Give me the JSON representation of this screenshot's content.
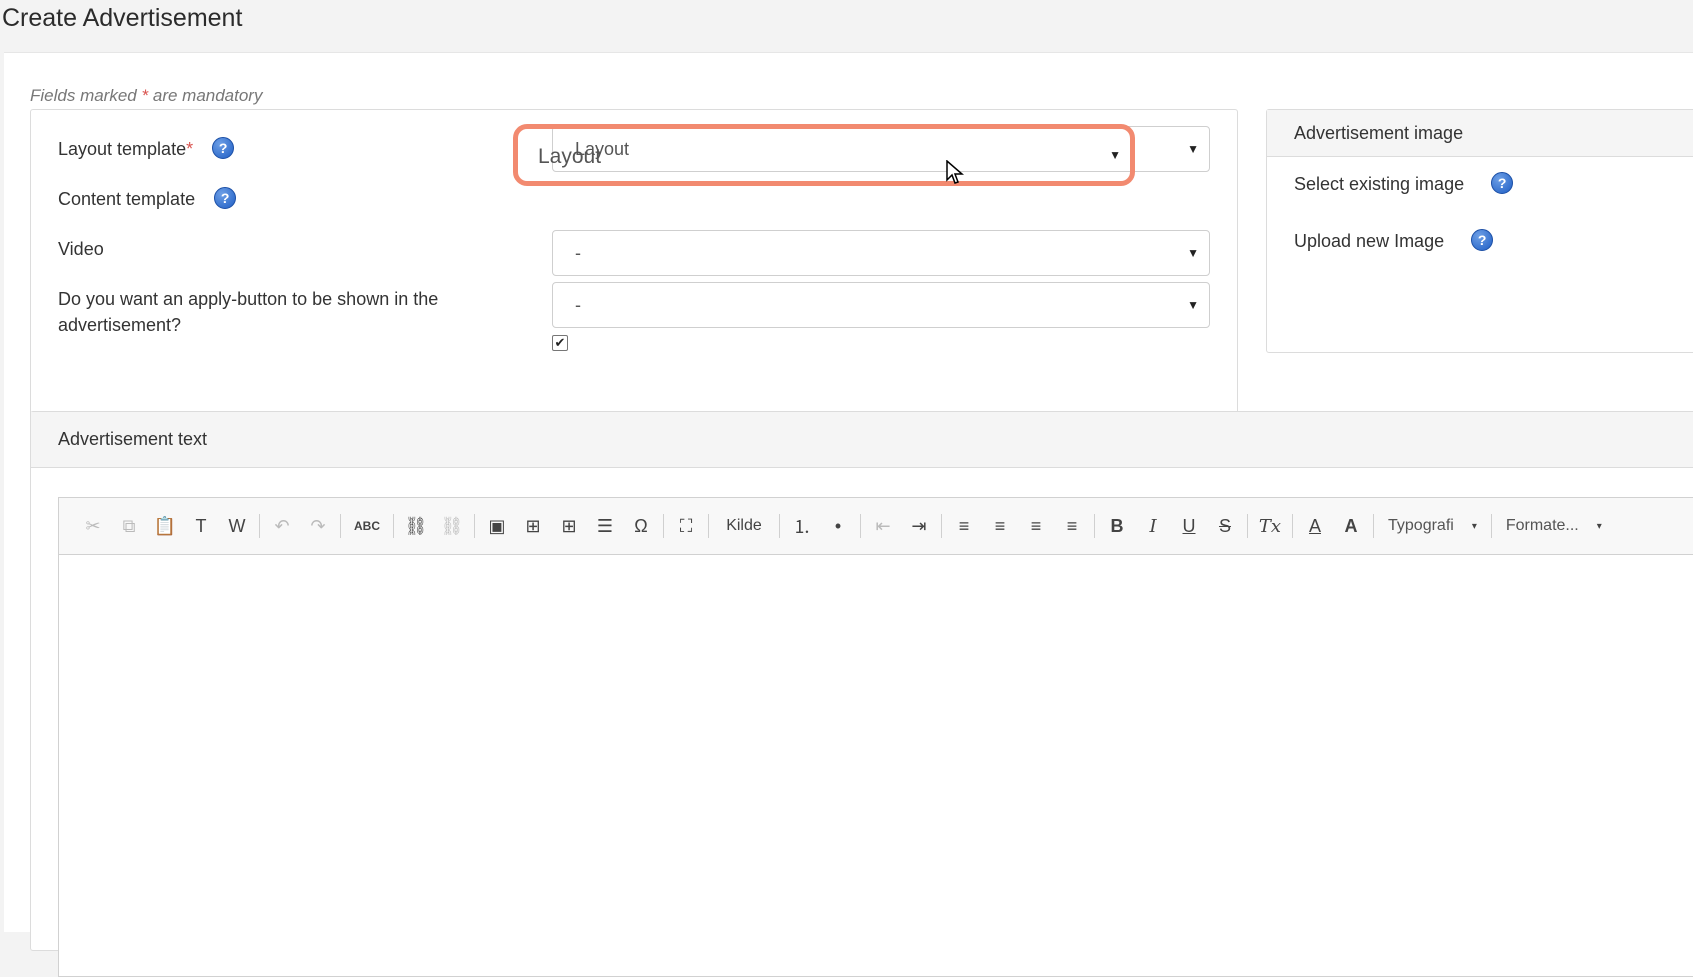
{
  "page": {
    "title": "Create Advertisement"
  },
  "form": {
    "mandatory_prefix": "Fields marked",
    "mandatory_star": "*",
    "mandatory_suffix": "are mandatory",
    "layout_template": {
      "label": "Layout template",
      "required_mark": "*",
      "value": "Layout"
    },
    "content_template": {
      "label": "Content template",
      "value": "-"
    },
    "video": {
      "label": "Video",
      "value": "-"
    },
    "apply_button": {
      "label_line1": "Do you want an apply-button to be shown in the",
      "label_line2": "advertisement?",
      "checked": true,
      "check_glyph": "✔"
    }
  },
  "image_panel": {
    "heading": "Advertisement image",
    "select_existing": "Select existing image",
    "upload_new": "Upload new Image"
  },
  "text_panel": {
    "heading": "Advertisement text",
    "toolbar": {
      "source_label": "Kilde",
      "typography_label": "Typografi",
      "format_label": "Formate..."
    }
  },
  "icons": {
    "help": "?",
    "caret": "▼",
    "dropdown_arrow": "▾",
    "cut": "✂",
    "copy": "⧉",
    "paste": "📋",
    "paste_text": "T",
    "paste_word": "W",
    "undo": "↶",
    "redo": "↷",
    "spellcheck": "ABC",
    "link": "⛓",
    "unlink": "⛓",
    "image": "▣",
    "iframe": "⊞",
    "table": "⊞",
    "hline": "☰",
    "special_char": "Ω",
    "maximize": "⛶",
    "numbered_list": "⒈",
    "bullet_list": "•",
    "outdent": "⇤",
    "indent": "⇥",
    "align_left": "≡",
    "align_center": "≡",
    "align_right": "≡",
    "justify": "≡",
    "bold": "B",
    "italic": "I",
    "underline": "U",
    "strike": "S",
    "remove_format": "Tx",
    "text_color": "A",
    "bg_color": "A"
  }
}
